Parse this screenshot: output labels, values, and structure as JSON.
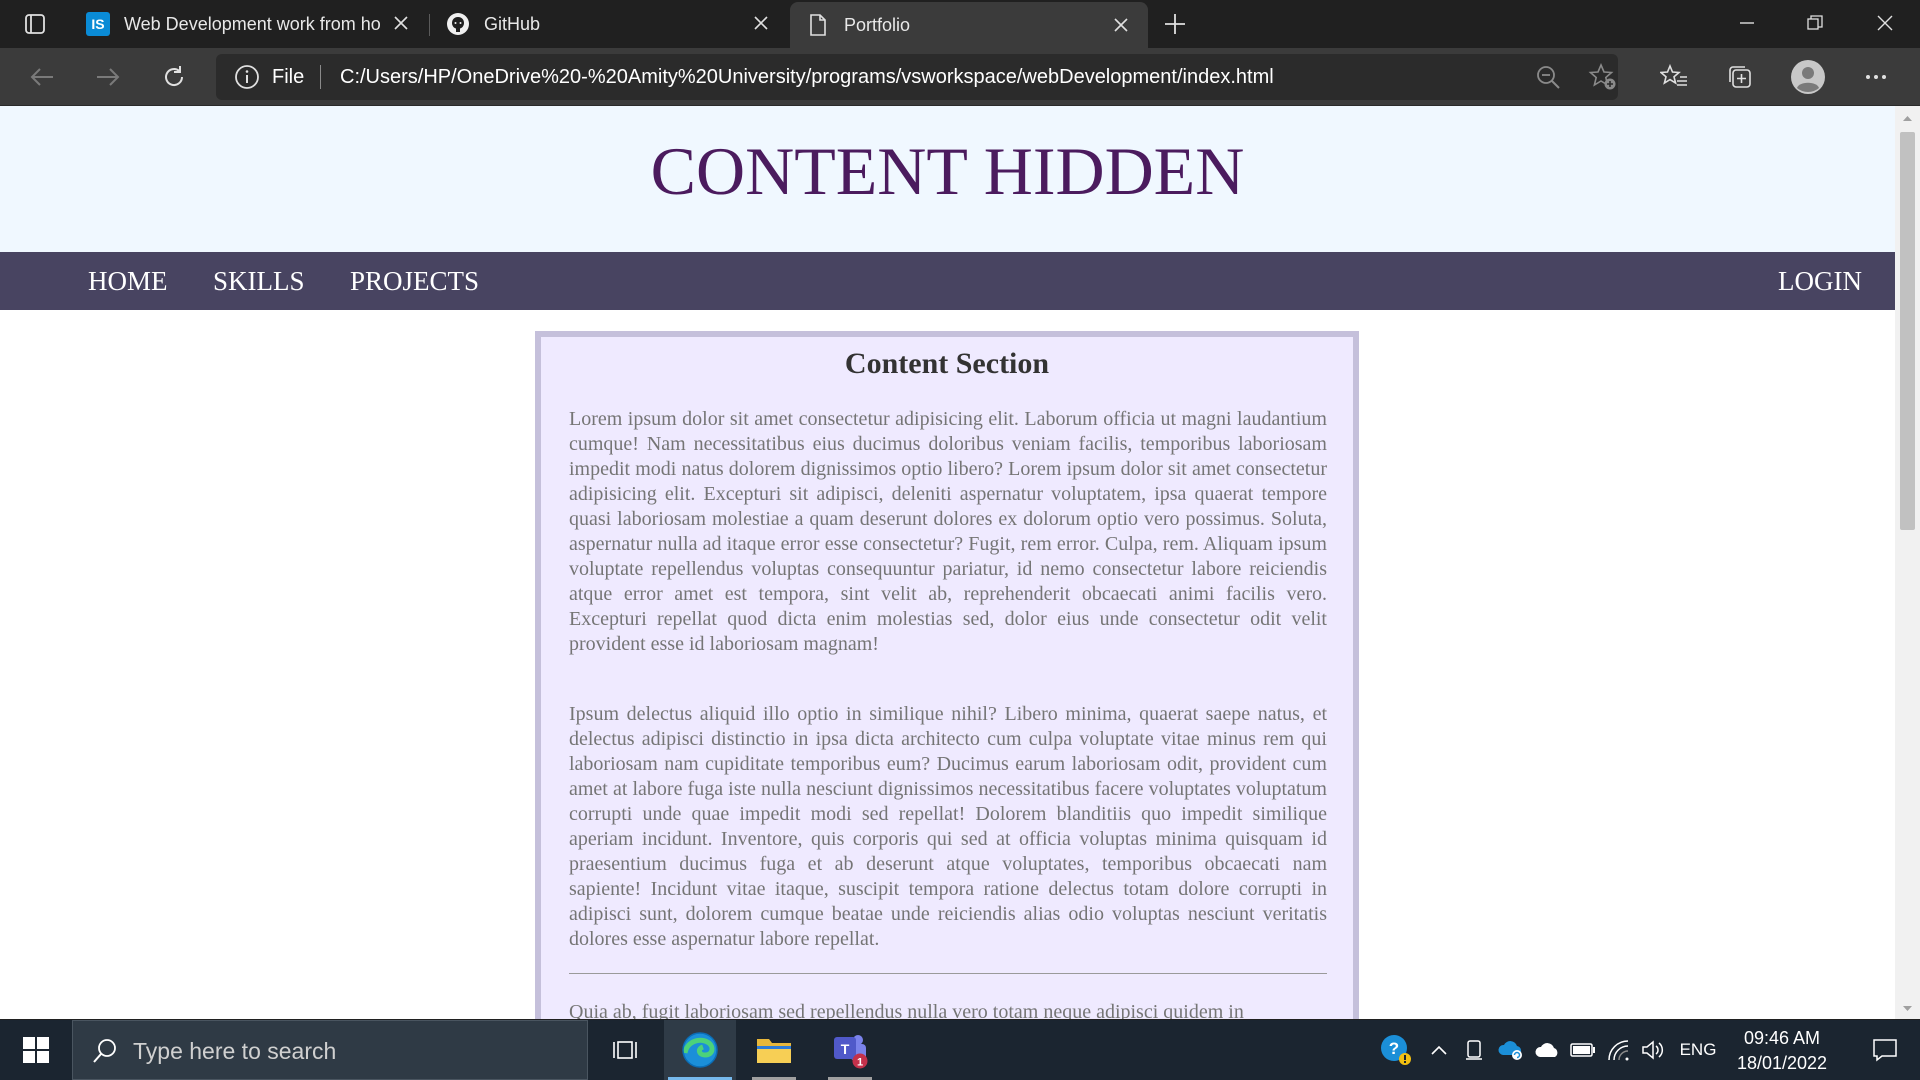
{
  "browser": {
    "tabs": [
      {
        "title": "Web Development work from ho",
        "icon": "is-logo-icon",
        "favicon_text": "IS"
      },
      {
        "title": "GitHub",
        "icon": "github-icon"
      },
      {
        "title": "Portfolio",
        "icon": "document-icon",
        "active": true
      }
    ],
    "address": {
      "scheme": "File",
      "url": "C:/Users/HP/OneDrive%20-%20Amity%20University/programs/vsworkspace/webDevelopment/index.html"
    }
  },
  "page": {
    "site_title": "CONTENT HIDDEN",
    "nav": {
      "home": "HOME",
      "skills": "SKILLS",
      "projects": "PROJECTS",
      "login": "LOGIN"
    },
    "content": {
      "title": "Content Section",
      "paragraphs": [
        "Lorem ipsum dolor sit amet consectetur adipisicing elit. Laborum officia ut magni laudantium cumque! Nam necessitatibus eius ducimus doloribus veniam facilis, temporibus laboriosam impedit modi natus dolorem dignissimos optio libero? Lorem ipsum dolor sit amet consectetur adipisicing elit. Excepturi sit adipisci, deleniti aspernatur voluptatem, ipsa quaerat tempore quasi laboriosam molestiae a quam deserunt dolores ex dolorum optio vero possimus. Soluta, aspernatur nulla ad itaque error esse consectetur? Fugit, rem error. Culpa, rem. Aliquam ipsum voluptate repellendus voluptas consequuntur pariatur, id nemo consectetur labore reiciendis atque error amet est tempora, sint velit ab, reprehenderit obcaecati animi facilis vero. Excepturi repellat quod dicta enim molestias sed, dolor eius unde consectetur odit velit provident esse id laboriosam magnam!",
        "Ipsum delectus aliquid illo optio in similique nihil? Libero minima, quaerat saepe natus, et delectus adipisci distinctio in ipsa dicta architecto cum culpa voluptate vitae minus rem qui laboriosam nam cupiditate temporibus eum? Ducimus earum laboriosam odit, provident cum amet at labore fuga iste nulla nesciunt dignissimos necessitatibus facere voluptates voluptatum corrupti unde quae impedit modi sed repellat! Dolorem blanditiis quo impedit similique aperiam incidunt. Inventore, quis corporis qui sed at officia voluptas minima quisquam id praesentium ducimus fuga et ab deserunt atque voluptates, temporibus obcaecati nam sapiente! Incidunt vitae itaque, suscipit tempora ratione delectus totam dolore corrupti in adipisci sunt, dolorem cumque beatae unde reiciendis alias odio voluptas nesciunt veritatis dolores esse aspernatur labore repellat.",
        "Quia ab, fugit laboriosam sed repellendus nulla vero totam neque adipisci quidem in"
      ]
    }
  },
  "taskbar": {
    "search_placeholder": "Type here to search",
    "teams_badge": "1",
    "language": "ENG",
    "time": "09:46 AM",
    "date": "18/01/2022"
  },
  "colors": {
    "site_title": "#4b1b5e",
    "header_bg": "#f0f8ff",
    "nav_bg": "#484461",
    "content_bg": "#efeaff",
    "content_border": "#c5c0db"
  }
}
